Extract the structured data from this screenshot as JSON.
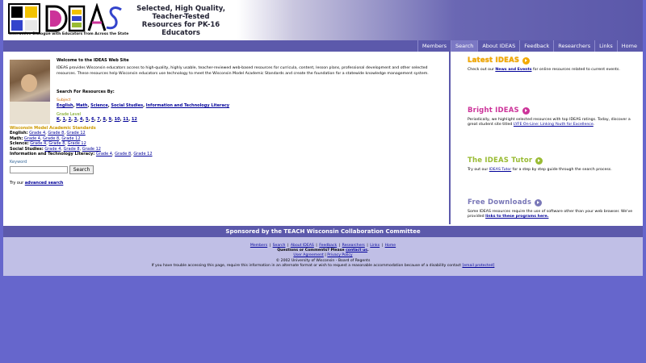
{
  "header": {
    "logo_letters": "IDEAS",
    "tagline": "Interactive Dialogue with Educators from Across the State",
    "hero_line1": "Selected, High Quality,",
    "hero_line2": "Teacher-Tested",
    "hero_line3": "Resources for PK-16 Educators"
  },
  "nav": {
    "items": [
      "Members",
      "Search",
      "About IDEAS",
      "Feedback",
      "Researchers",
      "Links",
      "Home"
    ],
    "active": "Search"
  },
  "main": {
    "welcome_title": "Welcome to the IDEAS Web Site",
    "welcome_text": "IDEAS provides Wisconsin educators access to high-quality, highly usable, teacher-reviewed web-based resources for curricula, content, lesson plans, professional development and other selected resources. These resources help Wisconsin educators use technology to meet the Wisconsin Model Academic Standards and create the foundation for a statewide knowledge management system.",
    "search_by": "Search For Resources By:",
    "subject_label": "Subject",
    "subjects": [
      "English",
      "Math",
      "Science",
      "Social Studies",
      "Information and Technology Literacy"
    ],
    "grade_label": "Grade Level",
    "grades": [
      "K",
      "1",
      "2",
      "3",
      "4",
      "5",
      "6",
      "7",
      "8",
      "9",
      "10",
      "11",
      "12"
    ],
    "standards_title": "Wisconsin Model Academic Standards",
    "standards": [
      {
        "name": "English:",
        "links": [
          "Grade 4",
          "Grade 8",
          "Grade 12"
        ]
      },
      {
        "name": "Math:",
        "links": [
          "Grade 4",
          "Grade 8",
          "Grade 12"
        ]
      },
      {
        "name": "Science:",
        "links": [
          "Grade 4",
          "Grade 8",
          "Grade 12"
        ]
      },
      {
        "name": "Social Studies:",
        "links": [
          "Grade 4",
          "Grade 8",
          "Grade 12"
        ]
      },
      {
        "name": "Information and Technology Literacy:",
        "links": [
          "Grade 4",
          "Grade 8",
          "Grade 12"
        ]
      }
    ],
    "keyword_label": "Keyword",
    "keyword_value": "",
    "search_button": "Search",
    "adv_prefix": "Try our ",
    "adv_link": "advanced search"
  },
  "side": {
    "blocks": [
      {
        "title": "Latest IDEAS",
        "desc_pre": "Check out our ",
        "link": "News and Events",
        "desc_post": " for online resources related to current events."
      },
      {
        "title": "Bright IDEAS",
        "desc_pre": "Periodically, we highlight selected resources with top IDEAS ratings. Today, discover a great student site titled ",
        "link": "LYFE On-Line: Linking Youth for Excellence",
        "desc_post": "."
      },
      {
        "title": "The IDEAS Tutor",
        "desc_pre": "Try out our ",
        "link": "IDEAS Tutor",
        "desc_post": " for a step by step guide through the search process."
      },
      {
        "title": "Free Downloads",
        "desc_pre": "Some IDEAS resources require the use of software other than your web browser. We've provided ",
        "link": "links to these programs here.",
        "desc_post": ""
      }
    ]
  },
  "sponsor": "Sponsored by the TEACH Wisconsin Collaboration Committee",
  "footer": {
    "links": [
      "Members",
      "Search",
      "About IDEAS",
      "Feedback",
      "Researchers",
      "Links",
      "Home"
    ],
    "questions_pre": "Questions or Comments? Please ",
    "questions_link": "contact us",
    "questions_post": ".",
    "agreement": "User Agreement",
    "privacy": "Privacy Policy",
    "copyright": "© 2002 University of Wisconsin - Board of Regents",
    "access_text": "If you have trouble accessing this page, require this information in an alternate format or wish to request a reasonable accommodation because of a disability contact ",
    "access_email": "[email protected]"
  },
  "colors": {
    "nav_bg": "#5c59ab",
    "page_bg": "#6666cc",
    "footer_bg": "#c0bfe6",
    "link": "#000099"
  }
}
